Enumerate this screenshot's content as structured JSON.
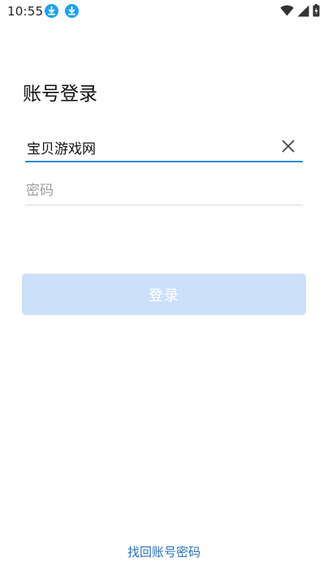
{
  "status_bar": {
    "time": "10:55",
    "icons": [
      "download-icon",
      "download-icon",
      "wifi-icon",
      "signal-icon",
      "battery-charging-icon"
    ]
  },
  "page": {
    "title": "账号登录"
  },
  "account_field": {
    "value": "宝贝游戏网",
    "clear_icon": "close-icon"
  },
  "password_field": {
    "placeholder": "密码",
    "value": ""
  },
  "login_button": {
    "label": "登录"
  },
  "recover_link": {
    "label": "找回账号密码"
  },
  "colors": {
    "accent": "#2a8ad7",
    "download_badge": "#1ba3e8",
    "button_disabled": "#cde0f9",
    "link": "#2a6fb8",
    "placeholder": "#9e9e9e",
    "divider": "#dcdcdc"
  }
}
